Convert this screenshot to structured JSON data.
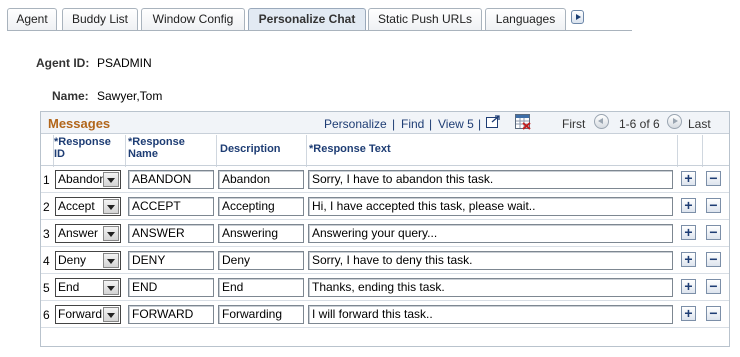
{
  "tabs": [
    {
      "label": "Agent",
      "active": false
    },
    {
      "label": "Buddy List",
      "active": false
    },
    {
      "label": "Window Config",
      "active": false
    },
    {
      "label": "Personalize Chat",
      "active": true
    },
    {
      "label": "Static Push URLs",
      "active": false
    },
    {
      "label": "Languages",
      "active": false
    }
  ],
  "agent": {
    "id_label": "Agent ID:",
    "id_value": "PSADMIN",
    "name_label": "Name:",
    "name_value": "Sawyer,Tom"
  },
  "grid": {
    "title": "Messages",
    "nav": {
      "personalize": "Personalize",
      "find": "Find",
      "view": "View 5",
      "first": "First",
      "range": "1-6 of 6",
      "last": "Last",
      "sep": "|"
    },
    "columns": {
      "response_id": "*Response ID",
      "response_name": "*Response Name",
      "description": "Description",
      "response_text": "*Response Text"
    },
    "rows": [
      {
        "num": "1",
        "response_id": "Abandon",
        "response_name": "ABANDON",
        "description": "Abandon",
        "response_text": "Sorry, I have to abandon this task."
      },
      {
        "num": "2",
        "response_id": "Accept",
        "response_name": "ACCEPT",
        "description": "Accepting",
        "response_text": "Hi, I have accepted this task, please wait.."
      },
      {
        "num": "3",
        "response_id": "Answer",
        "response_name": "ANSWER",
        "description": "Answering",
        "response_text": "Answering your query..."
      },
      {
        "num": "4",
        "response_id": "Deny",
        "response_name": "DENY",
        "description": "Deny",
        "response_text": "Sorry, I have to deny this task."
      },
      {
        "num": "5",
        "response_id": "End",
        "response_name": "END",
        "description": "End",
        "response_text": "Thanks, ending this task."
      },
      {
        "num": "6",
        "response_id": "Forward",
        "response_name": "FORWARD",
        "description": "Forwarding",
        "response_text": "I will forward this task.."
      }
    ],
    "add_symbol": "+",
    "remove_symbol": "−"
  }
}
